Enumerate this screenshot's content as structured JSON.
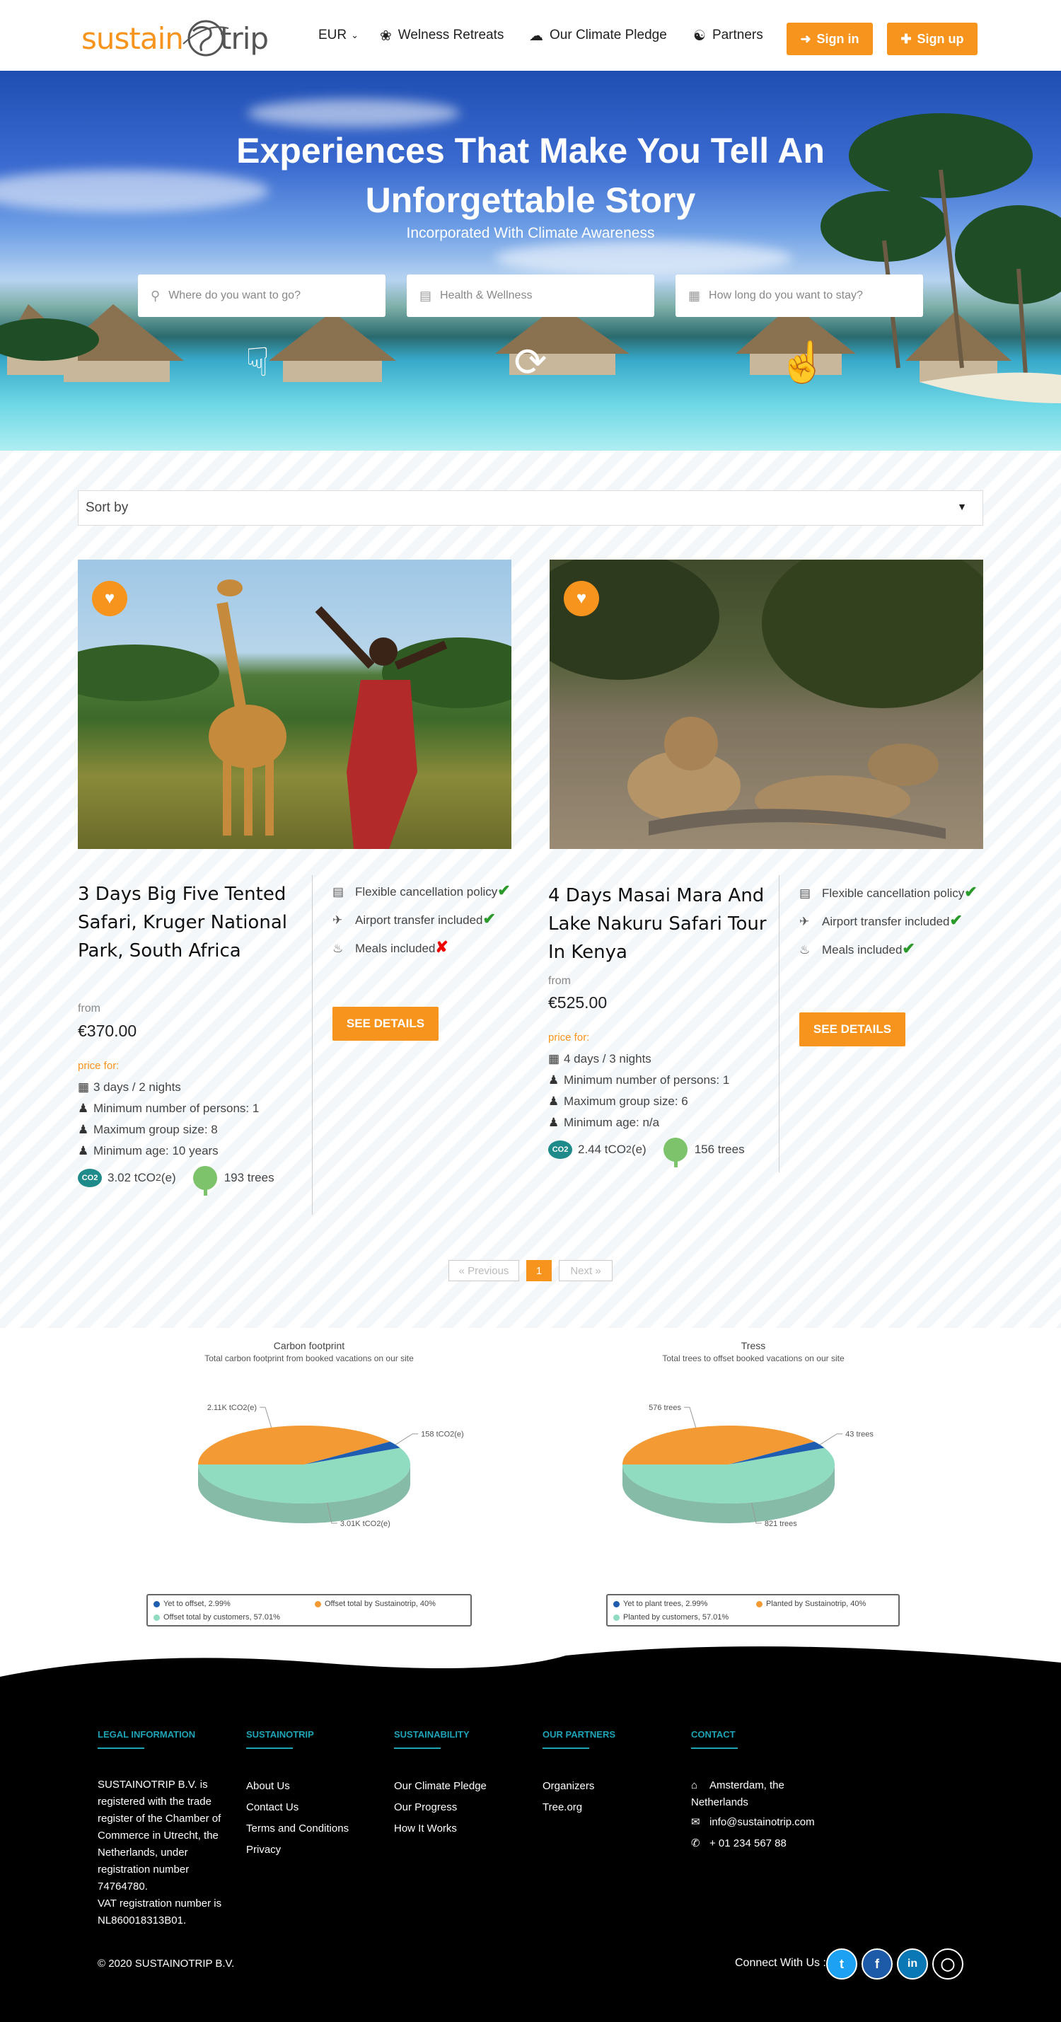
{
  "header": {
    "logo_part1": "sustain",
    "logo_part2": "trip",
    "currency": "EUR",
    "nav": [
      "Welness Retreats",
      "Our Climate Pledge",
      "Partners"
    ],
    "sign_in": "Sign in",
    "sign_up": "Sign up"
  },
  "hero": {
    "title": "Experiences That Make You Tell An Unforgettable Story",
    "subtitle": "Incorporated With Climate Awareness",
    "search": {
      "destination_placeholder": "Where do you want to go?",
      "category_placeholder": "Health & Wellness",
      "duration_placeholder": "How long do you want to stay?"
    }
  },
  "sort": {
    "label": "Sort by"
  },
  "cards": [
    {
      "title": "3 Days Big Five Tented Safari, Kruger National Park, South Africa",
      "from": "from",
      "price": "€370.00",
      "price_for": "price for:",
      "duration": "3 days / 2 nights",
      "min_persons": "Minimum number of persons: 1",
      "max_group": "Maximum group size: 8",
      "min_age": "Minimum age: 10 years",
      "co2": "3.02 tCO",
      "co2_sub": "2",
      "co2_unit": "(e)",
      "co2_badge": "CO2",
      "trees": "193 trees",
      "features": [
        {
          "label": "Flexible cancellation policy",
          "included": true
        },
        {
          "label": "Airport transfer included",
          "included": true
        },
        {
          "label": "Meals included",
          "included": false
        }
      ],
      "button": "SEE DETAILS"
    },
    {
      "title": "4 Days Masai Mara And Lake Nakuru Safari Tour In Kenya",
      "from": "from",
      "price": "€525.00",
      "price_for": "price for:",
      "duration": "4 days / 3 nights",
      "min_persons": "Minimum number of persons: 1",
      "max_group": "Maximum group size: 6",
      "min_age": "Minimum age: n/a",
      "co2": "2.44 tCO",
      "co2_sub": "2",
      "co2_unit": "(e)",
      "co2_badge": "CO2",
      "trees": "156 trees",
      "features": [
        {
          "label": "Flexible cancellation policy",
          "included": true
        },
        {
          "label": "Airport transfer included",
          "included": true
        },
        {
          "label": "Meals included",
          "included": true
        }
      ],
      "button": "SEE DETAILS"
    }
  ],
  "pagination": {
    "previous": "« Previous",
    "current": "1",
    "next": "Next »"
  },
  "chart_data": [
    {
      "type": "pie",
      "title": "Carbon footprint",
      "subtitle": "Total carbon footprint from booked vacations on our site",
      "slices": [
        {
          "name": "Offset total by customers",
          "value": 57.01,
          "label": "3.01K tCO2(e)",
          "color": "#8fdcc0"
        },
        {
          "name": "Offset total by Sustainotrip",
          "value": 40,
          "label": "2.11K tCO2(e)",
          "color": "#f39a34"
        },
        {
          "name": "Yet to offset",
          "value": 2.99,
          "label": "158 tCO2(e)",
          "color": "#1f5db0"
        }
      ],
      "legend": [
        "Yet to offset, 2.99%",
        "Offset total by Sustainotrip, 40%",
        "Offset total by customers, 57.01%"
      ]
    },
    {
      "type": "pie",
      "title": "Tress",
      "subtitle": "Total trees to offset booked vacations on our site",
      "slices": [
        {
          "name": "Planted by customers",
          "value": 57.01,
          "label": "821 trees",
          "color": "#8fdcc0"
        },
        {
          "name": "Planted by Sustainotrip",
          "value": 40,
          "label": "576 trees",
          "color": "#f39a34"
        },
        {
          "name": "Yet to plant trees",
          "value": 2.99,
          "label": "43 trees",
          "color": "#1f5db0"
        }
      ],
      "legend": [
        "Yet to plant trees, 2.99%",
        "Planted by Sustainotrip, 40%",
        "Planted by customers, 57.01%"
      ]
    }
  ],
  "footer": {
    "legal_heading": "LEGAL INFORMATION",
    "legal_text": [
      "SUSTAINOTRIP B.V. is",
      "registered with the trade",
      "register of the Chamber of",
      "Commerce in Utrecht, the",
      "Netherlands, under",
      "registration number",
      "74764780.",
      "VAT registration number is",
      "NL860018313B01."
    ],
    "sustainotrip_heading": "SUSTAINOTRIP",
    "sustainotrip_links": [
      "About Us",
      "Contact Us",
      "Terms and Conditions",
      "Privacy"
    ],
    "sustainability_heading": "SUSTAINABILITY",
    "sustainability_links": [
      "Our Climate Pledge",
      "Our Progress",
      "How It Works"
    ],
    "partners_heading": "OUR PARTNERS",
    "partners_links": [
      "Organizers",
      "Tree.org"
    ],
    "contact_heading": "CONTACT",
    "address_line1": "Amsterdam, the",
    "address_line2": "Netherlands",
    "email": "info@sustainotrip.com",
    "phone": "+ 01 234 567 88",
    "copyright": "© 2020 SUSTAINOTRIP B.V.",
    "connect": "Connect With Us :",
    "social": [
      "twitter",
      "facebook",
      "linkedin",
      "instagram"
    ]
  }
}
